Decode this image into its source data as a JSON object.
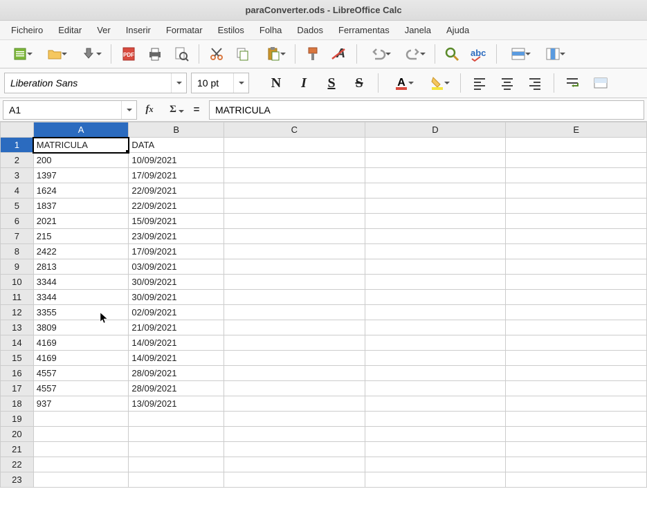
{
  "window": {
    "title": "paraConverter.ods - LibreOffice Calc"
  },
  "menus": [
    "Ficheiro",
    "Editar",
    "Ver",
    "Inserir",
    "Formatar",
    "Estilos",
    "Folha",
    "Dados",
    "Ferramentas",
    "Janela",
    "Ajuda"
  ],
  "font": {
    "name": "Liberation Sans",
    "size": "10 pt"
  },
  "nameBox": {
    "ref": "A1"
  },
  "formulaBar": {
    "value": "MATRICULA"
  },
  "columns": [
    "A",
    "B",
    "C",
    "D",
    "E"
  ],
  "selectedCell": "A1",
  "rows": [
    {
      "n": 1,
      "A": "MATRICULA",
      "B": "DATA"
    },
    {
      "n": 2,
      "A": "200",
      "B": "10/09/2021"
    },
    {
      "n": 3,
      "A": "1397",
      "B": "17/09/2021"
    },
    {
      "n": 4,
      "A": "1624",
      "B": "22/09/2021"
    },
    {
      "n": 5,
      "A": "1837",
      "B": "22/09/2021"
    },
    {
      "n": 6,
      "A": "2021",
      "B": "15/09/2021"
    },
    {
      "n": 7,
      "A": "215",
      "B": "23/09/2021"
    },
    {
      "n": 8,
      "A": "2422",
      "B": "17/09/2021"
    },
    {
      "n": 9,
      "A": "2813",
      "B": "03/09/2021"
    },
    {
      "n": 10,
      "A": "3344",
      "B": "30/09/2021"
    },
    {
      "n": 11,
      "A": "3344",
      "B": "30/09/2021"
    },
    {
      "n": 12,
      "A": "3355",
      "B": "02/09/2021"
    },
    {
      "n": 13,
      "A": "3809",
      "B": "21/09/2021"
    },
    {
      "n": 14,
      "A": "4169",
      "B": "14/09/2021"
    },
    {
      "n": 15,
      "A": "4169",
      "B": "14/09/2021"
    },
    {
      "n": 16,
      "A": "4557",
      "B": "28/09/2021"
    },
    {
      "n": 17,
      "A": "4557",
      "B": "28/09/2021"
    },
    {
      "n": 18,
      "A": "937",
      "B": "13/09/2021"
    },
    {
      "n": 19,
      "A": "",
      "B": ""
    },
    {
      "n": 20,
      "A": "",
      "B": ""
    },
    {
      "n": 21,
      "A": "",
      "B": ""
    },
    {
      "n": 22,
      "A": "",
      "B": ""
    },
    {
      "n": 23,
      "A": "",
      "B": ""
    }
  ]
}
